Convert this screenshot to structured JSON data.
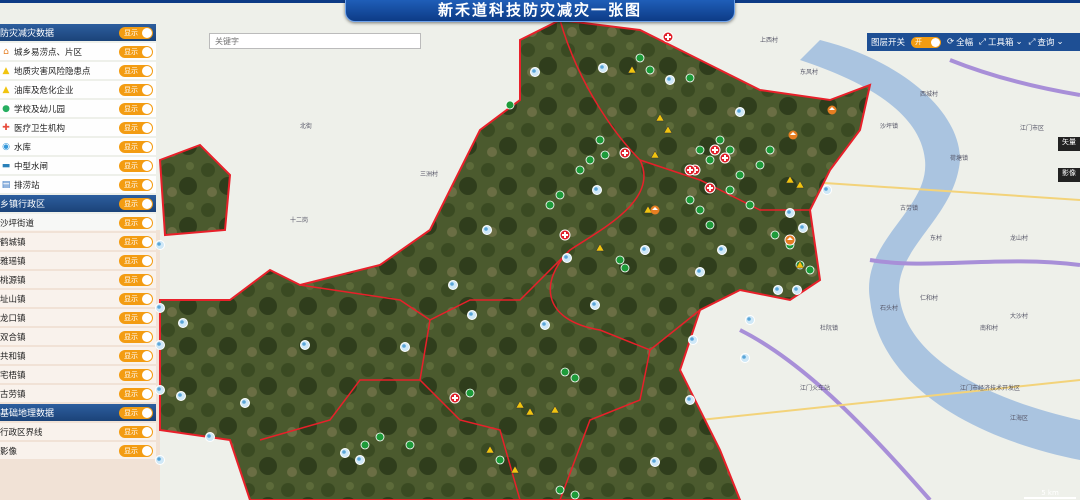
{
  "title": "新禾道科技防灾减灾一张图",
  "search": {
    "placeholder": "关键字"
  },
  "toolbar": {
    "layer_switch_label": "图层开关",
    "layer_switch_state": "开",
    "fullscreen_label": "全幅",
    "toolbox_label": "工具箱",
    "query_label": "查询"
  },
  "side": {
    "btn1": "矢量",
    "btn2": "影像"
  },
  "scale": "5 km",
  "panel": {
    "sections": [
      {
        "title": "防灾减灾数据",
        "toggle": "显示",
        "items": [
          {
            "label": "城乡易涝点、片区",
            "toggle": "显示",
            "icon": "house-icon",
            "color": "#e67e22"
          },
          {
            "label": "地质灾害风险隐患点",
            "toggle": "显示",
            "icon": "hazard-icon",
            "color": "#f1c40f"
          },
          {
            "label": "油库及危化企业",
            "toggle": "显示",
            "icon": "warning-icon",
            "color": "#f1c40f"
          },
          {
            "label": "学校及幼儿园",
            "toggle": "显示",
            "icon": "school-icon",
            "color": "#27ae60"
          },
          {
            "label": "医疗卫生机构",
            "toggle": "显示",
            "icon": "medical-icon",
            "color": "#e74c3c"
          },
          {
            "label": "水库",
            "toggle": "显示",
            "icon": "reservoir-icon",
            "color": "#3498db"
          },
          {
            "label": "中型水闸",
            "toggle": "显示",
            "icon": "sluice-icon",
            "color": "#2980b9"
          },
          {
            "label": "排涝站",
            "toggle": "显示",
            "icon": "pump-station-icon",
            "color": "#2c6fbf"
          }
        ]
      },
      {
        "title": "乡镇行政区",
        "toggle": "显示",
        "items": [
          {
            "label": "沙坪街道",
            "toggle": "显示"
          },
          {
            "label": "鹤城镇",
            "toggle": "显示"
          },
          {
            "label": "雅瑶镇",
            "toggle": "显示"
          },
          {
            "label": "桃源镇",
            "toggle": "显示"
          },
          {
            "label": "址山镇",
            "toggle": "显示"
          },
          {
            "label": "龙口镇",
            "toggle": "显示"
          },
          {
            "label": "双合镇",
            "toggle": "显示"
          },
          {
            "label": "共和镇",
            "toggle": "显示"
          },
          {
            "label": "宅梧镇",
            "toggle": "显示"
          },
          {
            "label": "古劳镇",
            "toggle": "显示"
          }
        ]
      },
      {
        "title": "基础地理数据",
        "toggle": "显示",
        "items": [
          {
            "label": "行政区界线",
            "toggle": "显示"
          },
          {
            "label": "影像",
            "toggle": "显示"
          }
        ]
      }
    ]
  },
  "map_labels": [
    "上西村",
    "东风村",
    "西城村",
    "沙坪镇",
    "江门市区",
    "荷塘镇",
    "古劳镇",
    "十二岗",
    "北街",
    "三洲村",
    "东村",
    "龙山村",
    "仁和村",
    "石头村",
    "大沙村",
    "南和村",
    "杜阮镇",
    "江门市经济技术开发区",
    "江门火车站",
    "江海区"
  ],
  "colors": {
    "accent": "#f39c12",
    "header": "#1b4379",
    "boundary": "#e8202a"
  }
}
